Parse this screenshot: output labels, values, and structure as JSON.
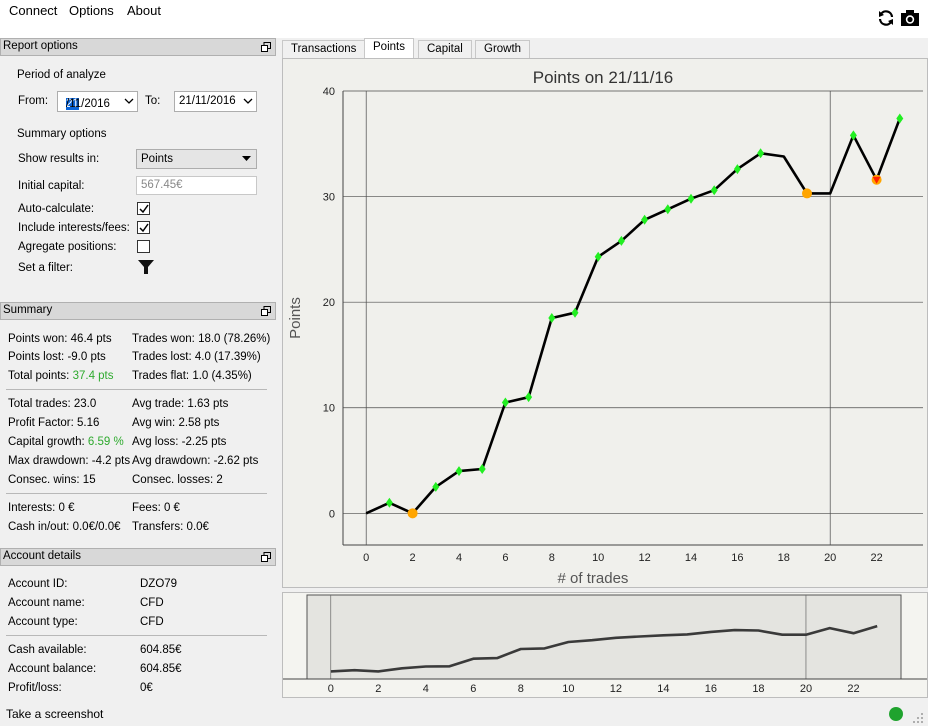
{
  "menu": {
    "connect": "Connect",
    "options": "Options",
    "about": "About"
  },
  "toolbar": {
    "refresh_icon": "refresh-icon",
    "camera_icon": "camera-icon"
  },
  "report_options": {
    "title": "Report options",
    "period_label": "Period of analyze",
    "from_label": "From:",
    "from_day": "21",
    "from_rest": "/11/2016",
    "to_label": "To:",
    "to_value": "21/11/2016",
    "summary_label": "Summary options",
    "show_results_label": "Show results in:",
    "show_results_value": "Points",
    "initial_capital_label": "Initial capital:",
    "initial_capital_value": "567.45€",
    "auto_calc_label": "Auto-calculate:",
    "auto_calc_checked": true,
    "include_fees_label": "Include interests/fees:",
    "include_fees_checked": true,
    "aggregate_label": "Agregate positions:",
    "aggregate_checked": false,
    "filter_label": "Set a filter:"
  },
  "summary": {
    "title": "Summary",
    "points_won_label": "Points won:",
    "points_won": "46.4 pts",
    "trades_won_label": "Trades won:",
    "trades_won": "18.0 (78.26%)",
    "points_lost_label": "Points lost:",
    "points_lost": "-9.0 pts",
    "trades_lost_label": "Trades lost:",
    "trades_lost": "4.0 (17.39%)",
    "total_points_label": "Total points:",
    "total_points": "37.4 pts",
    "trades_flat_label": "Trades flat:",
    "trades_flat": "1.0 (4.35%)",
    "total_trades_label": "Total trades:",
    "total_trades": "23.0",
    "avg_trade_label": "Avg trade:",
    "avg_trade": "1.63 pts",
    "profit_factor_label": "Profit Factor:",
    "profit_factor": "5.16",
    "avg_win_label": "Avg win:",
    "avg_win": "2.58 pts",
    "capital_growth_label": "Capital growth:",
    "capital_growth": "6.59 %",
    "avg_loss_label": "Avg loss:",
    "avg_loss": "-2.25 pts",
    "max_drawdown_label": "Max drawdown:",
    "max_drawdown": "-4.2 pts",
    "avg_drawdown_label": "Avg drawdown:",
    "avg_drawdown": "-2.62 pts",
    "consec_wins_label": "Consec. wins:",
    "consec_wins": "15",
    "consec_losses_label": "Consec. losses:",
    "consec_losses": "2",
    "interests_label": "Interests:",
    "interests": "0 €",
    "fees_label": "Fees:",
    "fees": "0 €",
    "cash_inout_label": "Cash in/out:",
    "cash_inout": "0.0€/0.0€",
    "transfers_label": "Transfers:",
    "transfers": "0.0€"
  },
  "account": {
    "title": "Account details",
    "id_label": "Account ID:",
    "id": "DZO79",
    "name_label": "Account name:",
    "name": "CFD",
    "type_label": "Account type:",
    "type": "CFD",
    "cash_label": "Cash available:",
    "cash": "604.85€",
    "balance_label": "Account balance:",
    "balance": "604.85€",
    "pl_label": "Profit/loss:",
    "pl": "0€"
  },
  "tabs": [
    "Transactions",
    "Points",
    "Capital",
    "Growth"
  ],
  "active_tab": "Points",
  "status": {
    "text": "Take a screenshot",
    "connected_color": "#1fa32e"
  },
  "colors": {
    "win_marker": "#22ee22",
    "flat_marker": "#ffa500",
    "loss_marker": "#ff2200",
    "line": "#000000",
    "plot_bg": "#f0f0ec"
  },
  "chart_data": {
    "type": "line",
    "title": "Points on 21/11/16",
    "xlabel": "# of trades",
    "ylabel": "Points",
    "xlim": [
      -1,
      24
    ],
    "ylim": [
      -3,
      40
    ],
    "xticks": [
      0,
      2,
      4,
      6,
      8,
      10,
      12,
      14,
      16,
      18,
      20,
      22
    ],
    "yticks": [
      0,
      10,
      20,
      30,
      40
    ],
    "grid": true,
    "x": [
      0,
      1,
      2,
      3,
      4,
      5,
      6,
      7,
      8,
      9,
      10,
      11,
      12,
      13,
      14,
      15,
      16,
      17,
      18,
      19,
      20,
      21,
      22,
      23
    ],
    "y": [
      0,
      1.0,
      0,
      2.5,
      4.0,
      4.2,
      10.5,
      11.0,
      18.5,
      19.0,
      24.3,
      25.8,
      27.8,
      28.8,
      29.8,
      30.6,
      32.6,
      34.1,
      33.8,
      30.3,
      30.3,
      35.8,
      31.6,
      37.4
    ],
    "markers": [
      "none",
      "win",
      "flat",
      "win",
      "win",
      "win",
      "win",
      "win",
      "win",
      "win",
      "win",
      "win",
      "win",
      "win",
      "win",
      "win",
      "win",
      "win",
      "none",
      "flat",
      "none",
      "win",
      "loss",
      "win"
    ]
  }
}
